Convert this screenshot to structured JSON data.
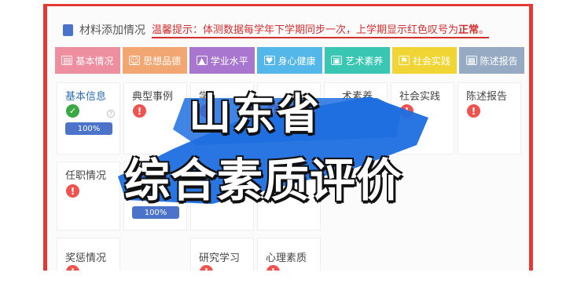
{
  "header": {
    "title": "材料添加情况",
    "notice_prefix": "温馨提示：体测数据每学年下学期同步一次，上学期显示红色叹号为",
    "notice_emphasis": "正常",
    "notice_suffix": "。"
  },
  "tabs": [
    {
      "label": "基本情况",
      "icon": "id-card-icon",
      "glyph": "▤",
      "color": "#ee8fa0"
    },
    {
      "label": "思想品德",
      "icon": "head-icon",
      "glyph": "☺",
      "color": "#f2a772"
    },
    {
      "label": "学业水平",
      "icon": "graduation-cap-icon",
      "glyph": "🎓",
      "color": "#a876cf"
    },
    {
      "label": "身心健康",
      "icon": "heart-icon",
      "glyph": "♥",
      "color": "#53b7ea"
    },
    {
      "label": "艺术素养",
      "icon": "picture-icon",
      "glyph": "▣",
      "color": "#39c7b4"
    },
    {
      "label": "社会实践",
      "icon": "flag-icon",
      "glyph": "⚑",
      "color": "#f0d534"
    },
    {
      "label": "陈述报告",
      "icon": "report-icon",
      "glyph": "▦",
      "color": "#96aac4"
    }
  ],
  "cards": [
    {
      "label": "基本信息",
      "status": "done",
      "progress_label": "100%",
      "progress": 1.0
    },
    {
      "label": "典型事例",
      "status": "warning"
    },
    {
      "label": "学",
      "status": "warning"
    },
    {
      "label": "",
      "status": "warning"
    },
    {
      "label": "术素养",
      "status": "warning"
    },
    {
      "label": "社会实践",
      "status": "warning"
    },
    {
      "label": "陈述报告",
      "status": "warning"
    },
    {
      "label": "任职情况",
      "status": "warning"
    },
    {
      "label": "",
      "status": "none",
      "progress_label": "100%",
      "progress": 1.0
    },
    {
      "label": "奖惩情况",
      "status": "warning"
    },
    {
      "label": "研究学习",
      "status": "warning"
    },
    {
      "label": "心理素质",
      "status": "warning"
    }
  ],
  "overlay": {
    "line1": "山东省",
    "line2": "综合素质评价",
    "brush_color": "#1e6fe0"
  }
}
